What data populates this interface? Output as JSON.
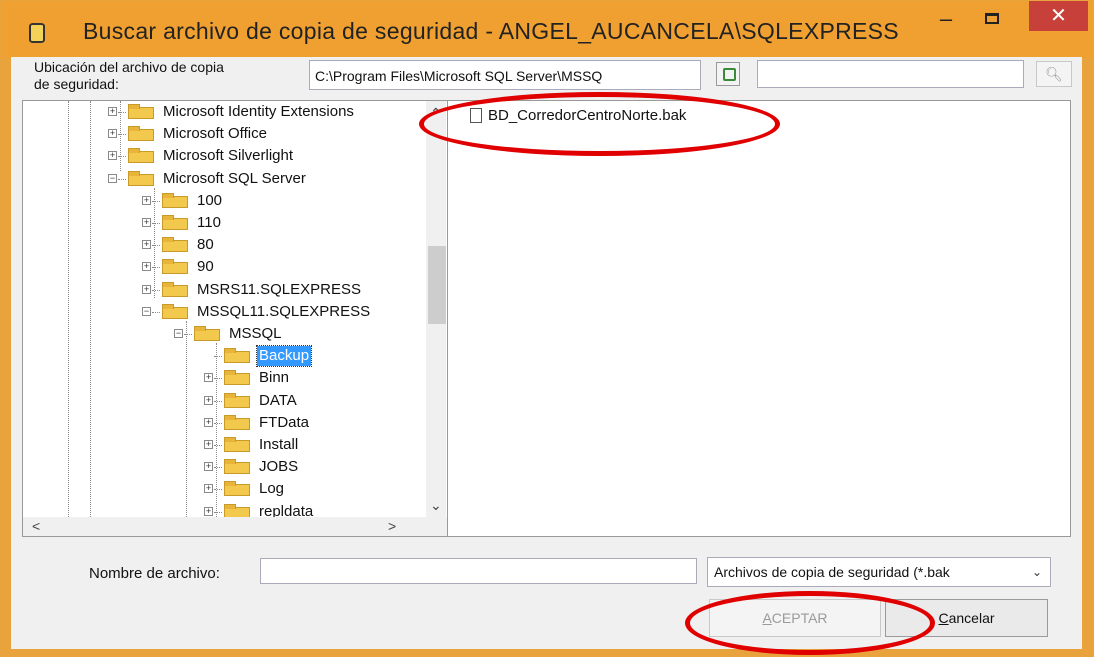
{
  "window": {
    "title": "Buscar archivo de copia de seguridad - ANGEL_AUCANCELA\\SQLEXPRESS",
    "min_glyph": "–",
    "close_glyph": "✕"
  },
  "location": {
    "label_line1": "Ubicación del archivo de copia",
    "label_line2": "de seguridad:",
    "path": "C:\\Program Files\\Microsoft SQL Server\\MSSQ",
    "search_value": ""
  },
  "tree": {
    "nodes": [
      {
        "label": "Microsoft Identity Extensions",
        "expander": "+"
      },
      {
        "label": "Microsoft Office",
        "expander": "+"
      },
      {
        "label": "Microsoft Silverlight",
        "expander": "+"
      },
      {
        "label": "Microsoft SQL Server",
        "expander": "−"
      },
      {
        "label": "100",
        "expander": "+"
      },
      {
        "label": "110",
        "expander": "+"
      },
      {
        "label": "80",
        "expander": "+"
      },
      {
        "label": "90",
        "expander": "+"
      },
      {
        "label": "MSRS11.SQLEXPRESS",
        "expander": "+"
      },
      {
        "label": "MSSQL11.SQLEXPRESS",
        "expander": "−"
      },
      {
        "label": "MSSQL",
        "expander": "−"
      },
      {
        "label": "Backup",
        "expander": "",
        "selected": true
      },
      {
        "label": "Binn",
        "expander": "+"
      },
      {
        "label": "DATA",
        "expander": "+"
      },
      {
        "label": "FTData",
        "expander": "+"
      },
      {
        "label": "Install",
        "expander": "+"
      },
      {
        "label": "JOBS",
        "expander": "+"
      },
      {
        "label": "Log",
        "expander": "+"
      },
      {
        "label": "repldata",
        "expander": "+"
      }
    ]
  },
  "files": [
    {
      "name": "BD_CorredorCentroNorte.bak"
    }
  ],
  "bottom": {
    "filename_label": "Nombre de archivo:",
    "filename_value": "",
    "filetype_selected": "Archivos de copia de seguridad (*.bak",
    "ok_label": "ACEPTAR",
    "cancel_label": "Cancelar"
  },
  "annotations": {
    "highlight_color": "#e00000"
  }
}
